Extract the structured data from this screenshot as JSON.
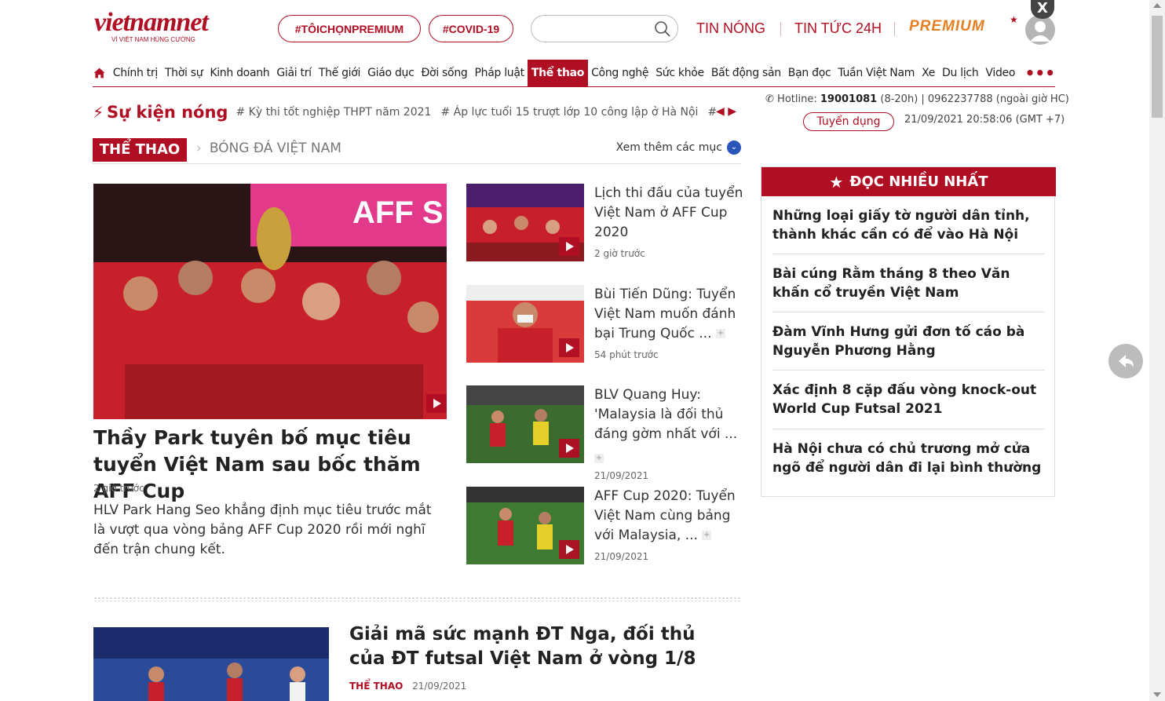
{
  "header": {
    "logo_text": "vietnamnet",
    "logo_tagline": "VÌ VIỆT NAM HÙNG CƯỜNG",
    "pill1": "#TÔICHỌNPREMIUM",
    "pill2": "#COVID-19",
    "search_placeholder": "",
    "link1": "TIN NÓNG",
    "link2": "TIN TỨC 24H",
    "premium": "PREMIUM",
    "close": "X"
  },
  "nav": {
    "items": [
      "Chính trị",
      "Thời sự",
      "Kinh doanh",
      "Giải trí",
      "Thế giới",
      "Giáo dục",
      "Đời sống",
      "Pháp luật",
      "Thể thao",
      "Công nghệ",
      "Sức khỏe",
      "Bất động sản",
      "Bạn đọc",
      "Tuần Việt Nam",
      "Xe",
      "Du lịch",
      "Video"
    ],
    "active": "Thể thao",
    "more": "•••"
  },
  "hot": {
    "label": "Sự kiện nóng",
    "tags": [
      "# Kỳ thi tốt nghiệp THPT năm 2021",
      "# Áp lực tuổi 15 trượt lớp 10 công lập ở Hà Nội",
      "#"
    ],
    "hotline_label": "Hotline:",
    "hotline_number": "19001081",
    "hotline_rest": "(8-20h) | 0962237788 (ngoài giờ HC)",
    "recruit": "Tuyển dụng",
    "datetime": "21/09/2021 20:58:06 (GMT +7)"
  },
  "section": {
    "main": "THỂ THAO",
    "sub": "BÓNG ĐÁ VIỆT NAM",
    "more": "Xem thêm các mục"
  },
  "feature": {
    "title": "Thầy Park tuyên bố mục tiêu tuyển Việt Nam sau bốc thăm AFF Cup",
    "time": "2 giờ trước",
    "desc": "HLV Park Hang Seo khẳng định mục tiêu trước mắt là vượt qua vòng bảng AFF Cup 2020 rồi mới nghĩ đến trận chung kết."
  },
  "side": [
    {
      "title": "Lịch thi đấu của tuyển Việt Nam ở AFF Cup 2020",
      "time": "2 giờ trước"
    },
    {
      "title": "Bùi Tiến Dũng: Tuyển Việt Nam muốn đánh bại Trung Quốc ...",
      "time": "54 phút trước"
    },
    {
      "title": "BLV Quang Huy: 'Malaysia là đối thủ đáng gờm nhất với ...",
      "time": "21/09/2021"
    },
    {
      "title": "AFF Cup 2020: Tuyển Việt Nam cùng bảng với Malaysia, ...",
      "time": "21/09/2021"
    }
  ],
  "bottom": {
    "title": "Giải mã sức mạnh ĐT Nga, đối thủ của ĐT futsal Việt Nam ở vòng 1/8",
    "category": "THỂ THAO",
    "time": "21/09/2021"
  },
  "most_read": {
    "heading": "ĐỌC NHIỀU NHẤT",
    "items": [
      "Những loại giấy tờ người dân tỉnh, thành khác cần có để vào Hà Nội",
      "Bài cúng Rằm tháng 8 theo Văn khấn cổ truyền Việt Nam",
      "Đàm Vĩnh Hưng gửi đơn tố cáo bà Nguyễn Phương Hằng",
      "Xác định 8 cặp đấu vòng knock-out World Cup Futsal 2021",
      "Hà Nội chưa có chủ trương mở cửa ngõ để người dân đi lại bình thường"
    ]
  },
  "colors": {
    "brand": "#b00e23",
    "premium": "#e67e22",
    "link_blue": "#2b54b8"
  }
}
